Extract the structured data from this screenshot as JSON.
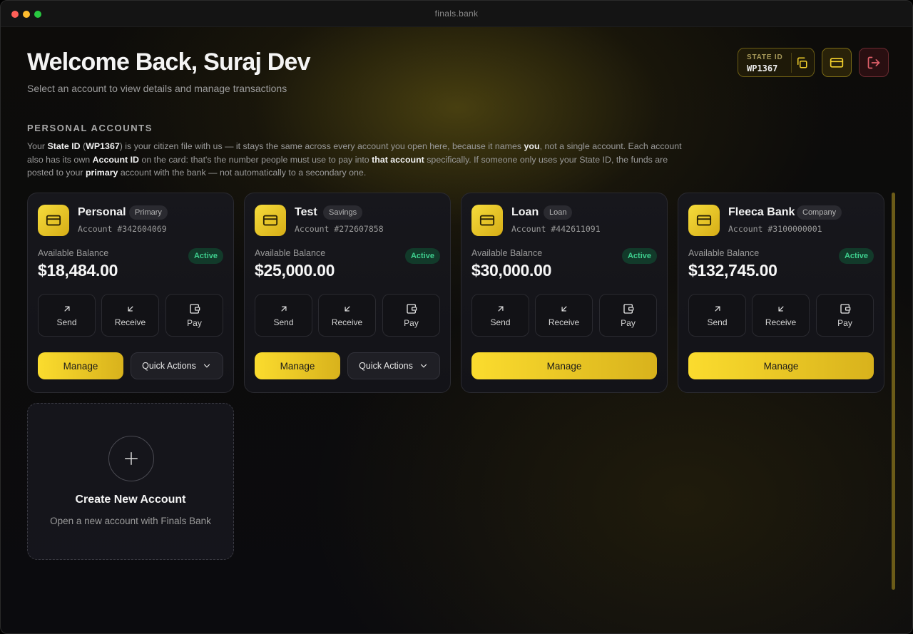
{
  "window": {
    "title": "finals.bank"
  },
  "header": {
    "welcome": "Welcome Back, Suraj Dev",
    "subtitle": "Select an account to view details and manage transactions",
    "state_id_label": "STATE ID",
    "state_id_value": "WP1367"
  },
  "section": {
    "title": "PERSONAL ACCOUNTS",
    "info": {
      "p1": "Your ",
      "b1": "State ID",
      "p2": " (",
      "b2": "WP1367",
      "p3": ") is your citizen file with us — it stays the same across every account you open here, because it names ",
      "b3": "you",
      "p4": ", not a single account. Each account also has its own ",
      "b4": "Account ID",
      "p5": " on the card: that's the number people must use to pay into ",
      "b5": "that account",
      "p6": " specifically. If someone only uses your State ID, the funds are posted to your ",
      "b6": "primary",
      "p7": " account with the bank — not automatically to a secondary one."
    }
  },
  "labels": {
    "available_balance": "Available Balance",
    "send": "Send",
    "receive": "Receive",
    "pay": "Pay",
    "manage": "Manage",
    "quick_actions": "Quick Actions"
  },
  "accounts": [
    {
      "name": "Personal",
      "type": "Primary",
      "number": "Account #342604069",
      "balance": "$18,484.00",
      "status": "Active"
    },
    {
      "name": "Test",
      "type": "Savings",
      "number": "Account #272607858",
      "balance": "$25,000.00",
      "status": "Active"
    },
    {
      "name": "Loan",
      "type": "Loan",
      "number": "Account #442611091",
      "balance": "$30,000.00",
      "status": "Active"
    },
    {
      "name": "Fleeca Bank",
      "type": "Company",
      "number": "Account #3100000001",
      "balance": "$132,745.00",
      "status": "Active"
    }
  ],
  "create": {
    "title": "Create New Account",
    "subtitle": "Open a new account with Finals Bank"
  },
  "icons": {
    "copy": "copy-icon",
    "card": "credit-card-icon",
    "logout": "logout-icon",
    "send": "arrow-up-right-icon",
    "receive": "arrow-down-left-icon",
    "pay": "wallet-icon",
    "plus": "plus-icon",
    "chevron": "chevron-down-icon"
  },
  "colors": {
    "accent": "#f6d32d",
    "status_active": "#3ecf8e",
    "logout": "#e0606a"
  }
}
